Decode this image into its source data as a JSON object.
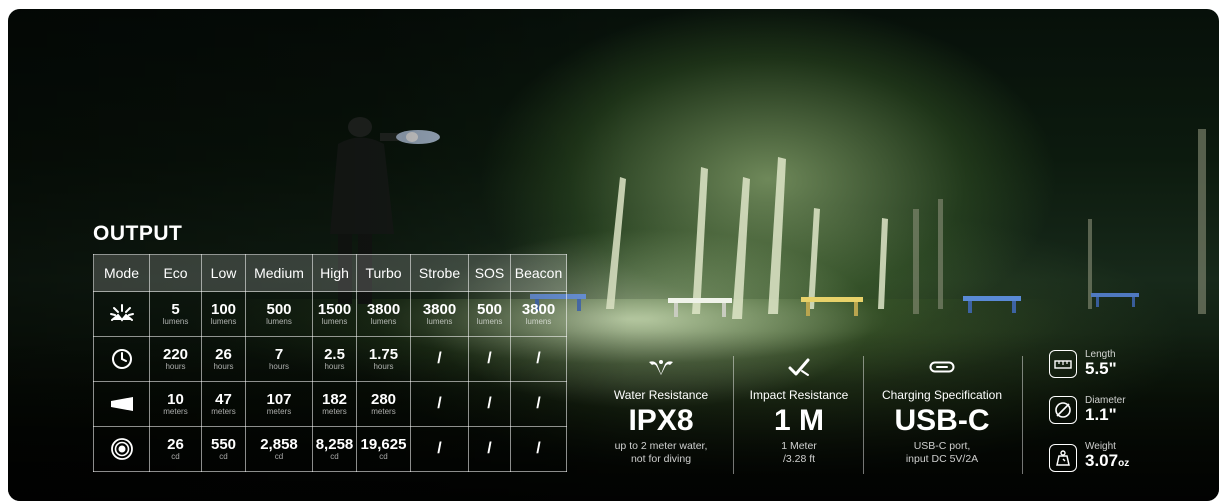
{
  "output": {
    "title": "OUTPUT",
    "headers": [
      "Mode",
      "Eco",
      "Low",
      "Medium",
      "High",
      "Turbo",
      "Strobe",
      "SOS",
      "Beacon"
    ],
    "rows": {
      "lumens": {
        "icon": "brightness-burst-icon",
        "cells": [
          {
            "v": "5",
            "u": "lumens"
          },
          {
            "v": "100",
            "u": "lumens"
          },
          {
            "v": "500",
            "u": "lumens"
          },
          {
            "v": "1500",
            "u": "lumens"
          },
          {
            "v": "3800",
            "u": "lumens"
          },
          {
            "v": "3800",
            "u": "lumens"
          },
          {
            "v": "500",
            "u": "lumens"
          },
          {
            "v": "3800",
            "u": "lumens"
          }
        ]
      },
      "runtime": {
        "icon": "clock-icon",
        "cells": [
          {
            "v": "220",
            "u": "hours"
          },
          {
            "v": "26",
            "u": "hours"
          },
          {
            "v": "7",
            "u": "hours"
          },
          {
            "v": "2.5",
            "u": "hours"
          },
          {
            "v": "1.75",
            "u": "hours"
          },
          {
            "v": "/"
          },
          {
            "v": "/"
          },
          {
            "v": "/"
          }
        ]
      },
      "distance": {
        "icon": "beam-distance-icon",
        "cells": [
          {
            "v": "10",
            "u": "meters"
          },
          {
            "v": "47",
            "u": "meters"
          },
          {
            "v": "107",
            "u": "meters"
          },
          {
            "v": "182",
            "u": "meters"
          },
          {
            "v": "280",
            "u": "meters"
          },
          {
            "v": "/"
          },
          {
            "v": "/"
          },
          {
            "v": "/"
          }
        ]
      },
      "intensity": {
        "icon": "target-rings-icon",
        "cells": [
          {
            "v": "26",
            "u": "cd"
          },
          {
            "v": "550",
            "u": "cd"
          },
          {
            "v": "2,858",
            "u": "cd"
          },
          {
            "v": "8,258",
            "u": "cd"
          },
          {
            "v": "19,625",
            "u": "cd"
          },
          {
            "v": "/"
          },
          {
            "v": "/"
          },
          {
            "v": "/"
          }
        ]
      }
    }
  },
  "specs": {
    "water": {
      "icon": "water-drop-icon",
      "label": "Water Resistance",
      "value": "IPX8",
      "sub1": "up to 2 meter water,",
      "sub2": "not for diving"
    },
    "impact": {
      "icon": "impact-check-icon",
      "label": "Impact Resistance",
      "value": "1 M",
      "sub1": "1 Meter",
      "sub2": "/3.28 ft"
    },
    "charging": {
      "icon": "usb-c-icon",
      "label": "Charging Specification",
      "value": "USB-C",
      "sub1": "USB-C port,",
      "sub2": "input DC 5V/2A"
    }
  },
  "dimensions": {
    "length": {
      "icon": "ruler-icon",
      "label": "Length",
      "value": "5.5\""
    },
    "diameter": {
      "icon": "diameter-icon",
      "label": "Diameter",
      "value": "1.1\""
    },
    "weight": {
      "icon": "weight-scale-icon",
      "label": "Weight",
      "value": "3.07",
      "unit": "oz"
    }
  },
  "colors": {
    "text": "#ffffff",
    "header_bg": "rgba(255,255,255,0.18)"
  }
}
